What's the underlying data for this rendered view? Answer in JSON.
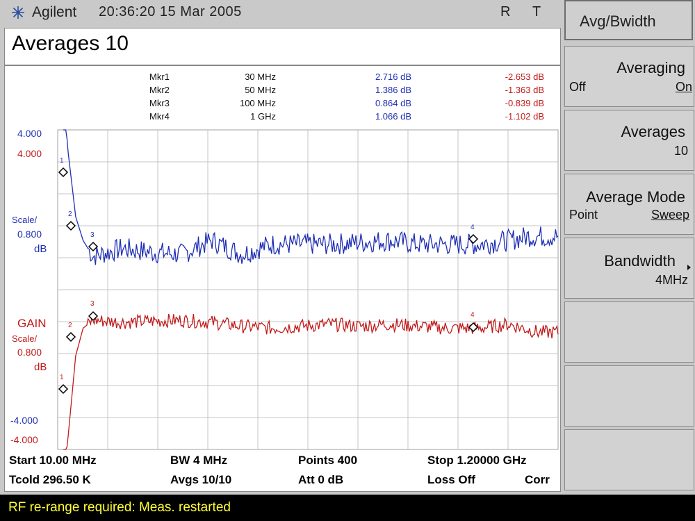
{
  "header": {
    "brand": "Agilent",
    "datetime": "20:36:20  15 Mar 2005",
    "flag_r": "R",
    "flag_t": "T",
    "title": "Averages 10"
  },
  "markers": [
    {
      "name": "Mkr1",
      "freq": "30 MHz",
      "nf": "2.716 dB",
      "gain": "-2.653 dB"
    },
    {
      "name": "Mkr2",
      "freq": "50 MHz",
      "nf": "1.386 dB",
      "gain": "-1.363 dB"
    },
    {
      "name": "Mkr3",
      "freq": "100 MHz",
      "nf": "0.864 dB",
      "gain": "-0.839 dB"
    },
    {
      "name": "Mkr4",
      "freq": "1 GHz",
      "nf": "1.066 dB",
      "gain": "-1.102 dB"
    }
  ],
  "scale": {
    "nf_top": "4.000",
    "gain_top": "4.000",
    "nf_scale1": "Scale/",
    "nf_scale2": "0.800",
    "nf_unit": "dB",
    "gain_label": "GAIN",
    "gain_scale1": "Scale/",
    "gain_scale2": "0.800",
    "gain_unit": "dB",
    "nf_bottom": "-4.000",
    "gain_bottom": "-4.000"
  },
  "footer": {
    "start": "Start 10.00 MHz",
    "bw": "BW 4 MHz",
    "points": "Points 400",
    "stop": "Stop 1.20000 GHz",
    "tcold": "Tcold 296.50 K",
    "avgs": "Avgs 10/10",
    "att": "Att 0 dB",
    "loss": "Loss Off",
    "corr": "Corr"
  },
  "softkeys": {
    "menu_title": "Avg/Bwidth",
    "averaging": {
      "label": "Averaging",
      "opt_off": "Off",
      "opt_on": "On"
    },
    "averages": {
      "label": "Averages",
      "value": "10"
    },
    "average_mode": {
      "label": "Average Mode",
      "opt_point": "Point",
      "opt_sweep": "Sweep"
    },
    "bandwidth": {
      "label": "Bandwidth",
      "value": "4MHz"
    }
  },
  "status": "RF re-range required: Meas. restarted",
  "chart_data": {
    "type": "line",
    "x_start_mhz": 10,
    "x_stop_mhz": 1200,
    "points": 400,
    "series": [
      {
        "color": "#1f2fb4",
        "scale_db_per_div": 0.8,
        "top_db": 4.0,
        "bottom_db": -4.0,
        "shape": [
          [
            0,
            4.0
          ],
          [
            0.01,
            2.6
          ],
          [
            0.025,
            1.0
          ],
          [
            0.04,
            0.4
          ],
          [
            0.06,
            0.0
          ],
          [
            0.12,
            0.2
          ],
          [
            0.18,
            0.1
          ],
          [
            0.24,
            0.05
          ],
          [
            0.3,
            0.4
          ],
          [
            0.36,
            0.05
          ],
          [
            0.42,
            0.3
          ],
          [
            0.48,
            0.3
          ],
          [
            0.54,
            0.3
          ],
          [
            0.6,
            0.35
          ],
          [
            0.66,
            0.4
          ],
          [
            0.72,
            0.3
          ],
          [
            0.78,
            0.3
          ],
          [
            0.84,
            0.3
          ],
          [
            0.9,
            0.4
          ],
          [
            0.94,
            0.5
          ],
          [
            1.0,
            0.5
          ]
        ]
      },
      {
        "color": "#c11a1a",
        "scale_db_per_div": 0.8,
        "top_db": 4.0,
        "bottom_db": -4.0,
        "shape": [
          [
            0,
            -4.0
          ],
          [
            0.01,
            -2.9
          ],
          [
            0.025,
            -0.9
          ],
          [
            0.04,
            -0.2
          ],
          [
            0.06,
            0.0
          ],
          [
            0.12,
            -0.05
          ],
          [
            0.18,
            -0.02
          ],
          [
            0.24,
            0.0
          ],
          [
            0.3,
            -0.05
          ],
          [
            0.36,
            -0.15
          ],
          [
            0.42,
            -0.2
          ],
          [
            0.48,
            -0.15
          ],
          [
            0.54,
            -0.1
          ],
          [
            0.6,
            -0.15
          ],
          [
            0.66,
            -0.1
          ],
          [
            0.72,
            -0.15
          ],
          [
            0.78,
            -0.2
          ],
          [
            0.84,
            -0.2
          ],
          [
            0.9,
            -0.1
          ],
          [
            0.96,
            -0.3
          ],
          [
            1.0,
            -0.3
          ]
        ]
      }
    ]
  }
}
